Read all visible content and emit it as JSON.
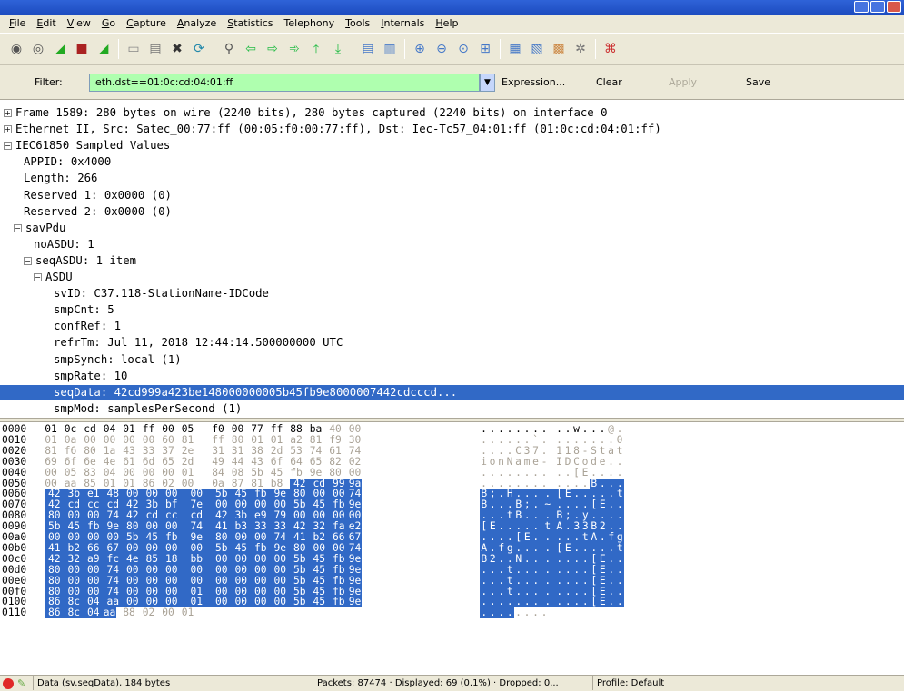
{
  "menu": [
    "File",
    "Edit",
    "View",
    "Go",
    "Capture",
    "Analyze",
    "Statistics",
    "Telephony",
    "Tools",
    "Internals",
    "Help"
  ],
  "menu_accel": [
    "F",
    "E",
    "V",
    "G",
    "C",
    "A",
    "S",
    "",
    "T",
    "I",
    "H"
  ],
  "toolbar_icons": [
    {
      "name": "interface-list-icon",
      "glyph": "◉"
    },
    {
      "name": "capture-options-icon",
      "glyph": "◎"
    },
    {
      "name": "start-capture-icon",
      "glyph": "◢"
    },
    {
      "name": "stop-capture-icon",
      "glyph": "■"
    },
    {
      "name": "restart-capture-icon",
      "glyph": "◢"
    },
    {
      "sep": true
    },
    {
      "name": "open-file-icon",
      "glyph": "▭"
    },
    {
      "name": "save-file-icon",
      "glyph": "▤"
    },
    {
      "name": "close-file-icon",
      "glyph": "✖"
    },
    {
      "name": "reload-icon",
      "glyph": "⟳"
    },
    {
      "sep": true
    },
    {
      "name": "find-packet-icon",
      "glyph": "⚲"
    },
    {
      "name": "go-back-icon",
      "glyph": "⇦"
    },
    {
      "name": "go-forward-icon",
      "glyph": "⇨"
    },
    {
      "name": "go-to-packet-icon",
      "glyph": "➾"
    },
    {
      "name": "first-packet-icon",
      "glyph": "⤒"
    },
    {
      "name": "last-packet-icon",
      "glyph": "⤓"
    },
    {
      "sep": true
    },
    {
      "name": "colorize-icon",
      "glyph": "▤"
    },
    {
      "name": "auto-scroll-icon",
      "glyph": "▥"
    },
    {
      "sep": true
    },
    {
      "name": "zoom-in-icon",
      "glyph": "⊕"
    },
    {
      "name": "zoom-out-icon",
      "glyph": "⊖"
    },
    {
      "name": "normal-size-icon",
      "glyph": "⊙"
    },
    {
      "name": "resize-columns-icon",
      "glyph": "⊞"
    },
    {
      "sep": true
    },
    {
      "name": "capture-filters-icon",
      "glyph": "▦"
    },
    {
      "name": "display-filters-icon",
      "glyph": "▧"
    },
    {
      "name": "coloring-rules-icon",
      "glyph": "▩"
    },
    {
      "name": "preferences-icon",
      "glyph": "✲"
    },
    {
      "sep": true
    },
    {
      "name": "help-icon",
      "glyph": "⌘"
    }
  ],
  "filter": {
    "label": "Filter:",
    "value": "eth.dst==01:0c:cd:04:01:ff",
    "expression": "Expression...",
    "clear": "Clear",
    "apply": "Apply",
    "save": "Save"
  },
  "tree": [
    {
      "indent": 0,
      "toggle": "+",
      "text": "Frame 1589: 280 bytes on wire (2240 bits), 280 bytes captured (2240 bits) on interface 0"
    },
    {
      "indent": 0,
      "toggle": "+",
      "text": "Ethernet II, Src: Satec_00:77:ff (00:05:f0:00:77:ff), Dst: Iec-Tc57_04:01:ff (01:0c:cd:04:01:ff)"
    },
    {
      "indent": 0,
      "toggle": "-",
      "text": "IEC61850 Sampled Values"
    },
    {
      "indent": 2,
      "toggle": "",
      "text": "APPID: 0x4000"
    },
    {
      "indent": 2,
      "toggle": "",
      "text": "Length: 266"
    },
    {
      "indent": 2,
      "toggle": "",
      "text": "Reserved 1: 0x0000 (0)"
    },
    {
      "indent": 2,
      "toggle": "",
      "text": "Reserved 2: 0x0000 (0)"
    },
    {
      "indent": 1,
      "toggle": "-",
      "text": "savPdu"
    },
    {
      "indent": 3,
      "toggle": "",
      "text": "noASDU: 1"
    },
    {
      "indent": 2,
      "toggle": "-",
      "text": "seqASDU: 1 item"
    },
    {
      "indent": 3,
      "toggle": "-",
      "text": "ASDU"
    },
    {
      "indent": 5,
      "toggle": "",
      "text": "svID: C37.118-StationName-IDCode"
    },
    {
      "indent": 5,
      "toggle": "",
      "text": "smpCnt: 5"
    },
    {
      "indent": 5,
      "toggle": "",
      "text": "confRef: 1"
    },
    {
      "indent": 5,
      "toggle": "",
      "text": "refrTm: Jul 11, 2018 12:44:14.500000000 UTC"
    },
    {
      "indent": 5,
      "toggle": "",
      "text": "smpSynch: local (1)"
    },
    {
      "indent": 5,
      "toggle": "",
      "text": "smpRate: 10"
    },
    {
      "indent": 5,
      "toggle": "",
      "text": "seqData: 42cd999a423be148000000005b45fb9e8000007442cdcccd...",
      "selected": true
    },
    {
      "indent": 5,
      "toggle": "",
      "text": "smpMod: samplesPerSecond (1)"
    }
  ],
  "hex_rows": [
    {
      "offset": "0000",
      "bytes": [
        "01",
        "0c",
        "cd",
        "04",
        "01",
        "ff",
        "00",
        "05",
        "f0",
        "00",
        "77",
        "ff",
        "88",
        "ba",
        "40",
        "00"
      ],
      "ascii": "........ ..w...@."
    },
    {
      "offset": "0010",
      "bytes": [
        "01",
        "0a",
        "00",
        "00",
        "00",
        "00",
        "60",
        "81",
        "ff",
        "80",
        "01",
        "01",
        "a2",
        "81",
        "f9",
        "30"
      ],
      "ascii": "......`. .......0"
    },
    {
      "offset": "0020",
      "bytes": [
        "81",
        "f6",
        "80",
        "1a",
        "43",
        "33",
        "37",
        "2e",
        "31",
        "31",
        "38",
        "2d",
        "53",
        "74",
        "61",
        "74"
      ],
      "ascii": "....C37. 118-Stat"
    },
    {
      "offset": "0030",
      "bytes": [
        "69",
        "6f",
        "6e",
        "4e",
        "61",
        "6d",
        "65",
        "2d",
        "49",
        "44",
        "43",
        "6f",
        "64",
        "65",
        "82",
        "02"
      ],
      "ascii": "ionName- IDCode.."
    },
    {
      "offset": "0040",
      "bytes": [
        "00",
        "05",
        "83",
        "04",
        "00",
        "00",
        "00",
        "01",
        "84",
        "08",
        "5b",
        "45",
        "fb",
        "9e",
        "80",
        "00"
      ],
      "ascii": "........ ..[E...."
    },
    {
      "offset": "0050",
      "bytes": [
        "00",
        "aa",
        "85",
        "01",
        "01",
        "86",
        "02",
        "00",
        "0a",
        "87",
        "81",
        "b8",
        "42",
        "cd",
        "99",
        "9a"
      ],
      "ascii": "........ ....B..."
    },
    {
      "offset": "0060",
      "bytes": [
        "42",
        "3b",
        "e1",
        "48",
        "00",
        "00",
        "00",
        "00",
        "5b",
        "45",
        "fb",
        "9e",
        "80",
        "00",
        "00",
        "74"
      ],
      "ascii": "B;.H.... [E.....t"
    },
    {
      "offset": "0070",
      "bytes": [
        "42",
        "cd",
        "cc",
        "cd",
        "42",
        "3b",
        "bf",
        "7e",
        "00",
        "00",
        "00",
        "00",
        "5b",
        "45",
        "fb",
        "9e"
      ],
      "ascii": "B...B;.~ ....[E.."
    },
    {
      "offset": "0080",
      "bytes": [
        "80",
        "00",
        "00",
        "74",
        "42",
        "cd",
        "cc",
        "cd",
        "42",
        "3b",
        "e9",
        "79",
        "00",
        "00",
        "00",
        "00"
      ],
      "ascii": "...tB... B;.y...."
    },
    {
      "offset": "0090",
      "bytes": [
        "5b",
        "45",
        "fb",
        "9e",
        "80",
        "00",
        "00",
        "74",
        "41",
        "b3",
        "33",
        "33",
        "42",
        "32",
        "fa",
        "e2"
      ],
      "ascii": "[E.....t A.33B2.."
    },
    {
      "offset": "00a0",
      "bytes": [
        "00",
        "00",
        "00",
        "00",
        "5b",
        "45",
        "fb",
        "9e",
        "80",
        "00",
        "00",
        "74",
        "41",
        "b2",
        "66",
        "67"
      ],
      "ascii": "....[E.. ...tA.fg"
    },
    {
      "offset": "00b0",
      "bytes": [
        "41",
        "b2",
        "66",
        "67",
        "00",
        "00",
        "00",
        "00",
        "5b",
        "45",
        "fb",
        "9e",
        "80",
        "00",
        "00",
        "74"
      ],
      "ascii": "A.fg.... [E.....t"
    },
    {
      "offset": "00c0",
      "bytes": [
        "42",
        "32",
        "a9",
        "fc",
        "4e",
        "85",
        "18",
        "bb",
        "00",
        "00",
        "00",
        "00",
        "5b",
        "45",
        "fb",
        "9e"
      ],
      "ascii": "B2..N... ....[E.."
    },
    {
      "offset": "00d0",
      "bytes": [
        "80",
        "00",
        "00",
        "74",
        "00",
        "00",
        "00",
        "00",
        "00",
        "00",
        "00",
        "00",
        "5b",
        "45",
        "fb",
        "9e"
      ],
      "ascii": "...t.... ....[E.."
    },
    {
      "offset": "00e0",
      "bytes": [
        "80",
        "00",
        "00",
        "74",
        "00",
        "00",
        "00",
        "00",
        "00",
        "00",
        "00",
        "00",
        "5b",
        "45",
        "fb",
        "9e"
      ],
      "ascii": "...t.... ....[E.."
    },
    {
      "offset": "00f0",
      "bytes": [
        "80",
        "00",
        "00",
        "74",
        "00",
        "00",
        "00",
        "01",
        "00",
        "00",
        "00",
        "00",
        "5b",
        "45",
        "fb",
        "9e"
      ],
      "ascii": "...t.... ....[E.."
    },
    {
      "offset": "0100",
      "bytes": [
        "86",
        "8c",
        "04",
        "aa",
        "00",
        "00",
        "00",
        "01",
        "00",
        "00",
        "00",
        "00",
        "5b",
        "45",
        "fb",
        "9e"
      ],
      "ascii": "........ ....[E.."
    },
    {
      "offset": "0110",
      "bytes": [
        "86",
        "8c",
        "04",
        "aa",
        "88",
        "02",
        "00",
        "01"
      ],
      "ascii": "........"
    }
  ],
  "status": {
    "field": "Data (sv.seqData), 184 bytes",
    "packets": "Packets: 87474 · Displayed: 69 (0.1%) · Dropped: 0...",
    "profile": "Profile: Default"
  },
  "colors": {
    "selection": "#3169c6",
    "filter_ok": "#afffaf",
    "context_byte": "#aaa397"
  }
}
